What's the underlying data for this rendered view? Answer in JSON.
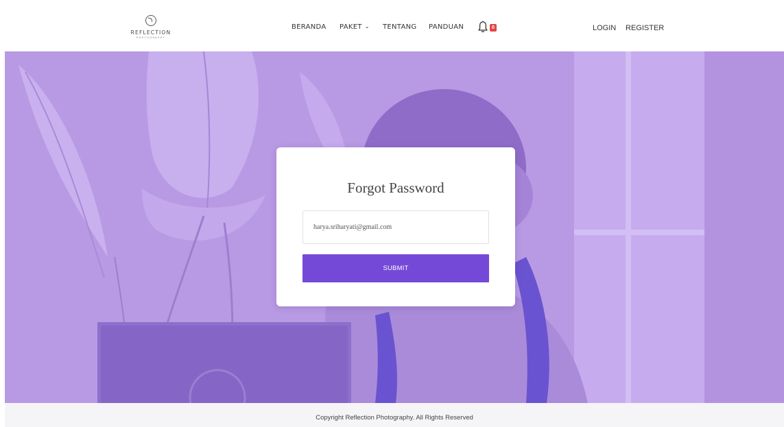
{
  "brand": {
    "name": "REFLECTION",
    "sub": "PHOTOGRAPHY",
    "logo_icon": "reflection-logo-icon"
  },
  "nav": {
    "items": [
      {
        "label": "BERANDA"
      },
      {
        "label": "PAKET",
        "icon": "chevron-down-icon"
      },
      {
        "label": "TENTANG"
      },
      {
        "label": "PANDUAN"
      }
    ],
    "notification_icon": "bell-icon",
    "notification_count": "0"
  },
  "auth": {
    "login_label": "LOGIN",
    "register_label": "REGISTER"
  },
  "form": {
    "title": "Forgot Password",
    "email_value": "harya.sriharyati@gmail.com",
    "submit_label": "SUBMIT"
  },
  "footer": {
    "copyright": "Copyright Reflection Photography. All Rights Reserved"
  },
  "colors": {
    "accent": "#7549d8",
    "hero_overlay": "#b99ae6",
    "badge": "#e24545",
    "footer_bg": "#f5f4f6"
  }
}
